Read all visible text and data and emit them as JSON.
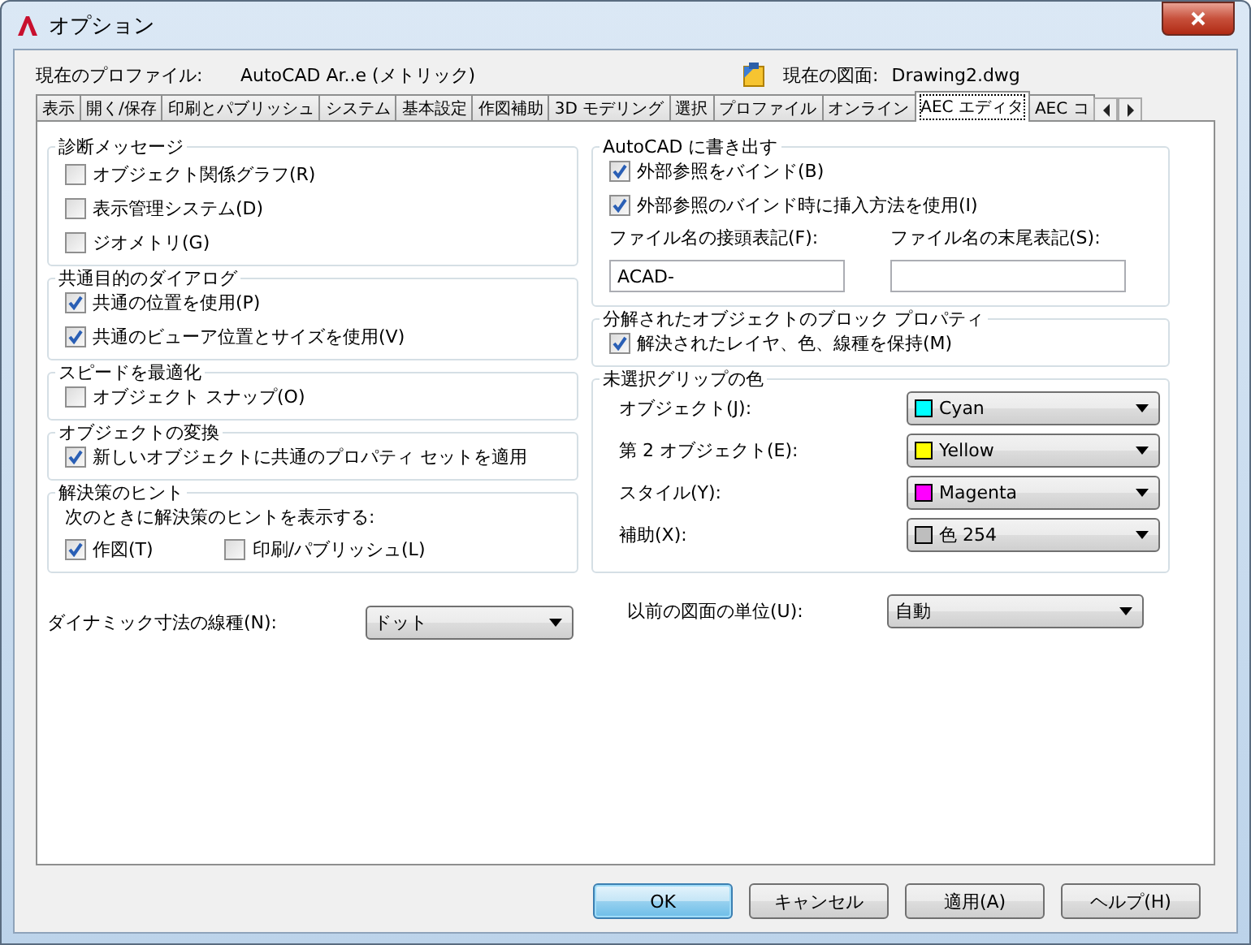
{
  "window": {
    "title": "オプション"
  },
  "profile": {
    "label": "現在のプロファイル:",
    "value": "AutoCAD Ar..e (メトリック)"
  },
  "drawing": {
    "label": "現在の図面:",
    "value": "Drawing2.dwg"
  },
  "tabs": [
    {
      "label": "表示",
      "selected": false
    },
    {
      "label": "開く/保存",
      "selected": false
    },
    {
      "label": "印刷とパブリッシュ",
      "selected": false
    },
    {
      "label": "システム",
      "selected": false
    },
    {
      "label": "基本設定",
      "selected": false
    },
    {
      "label": "作図補助",
      "selected": false
    },
    {
      "label": "3D モデリング",
      "selected": false
    },
    {
      "label": "選択",
      "selected": false
    },
    {
      "label": "プロファイル",
      "selected": false
    },
    {
      "label": "オンライン",
      "selected": false
    },
    {
      "label": "AEC エディタ",
      "selected": true
    },
    {
      "label": "AEC コ",
      "selected": false
    }
  ],
  "left_groups": [
    {
      "title": "診断メッセージ",
      "items": [
        {
          "label": "オブジェクト関係グラフ(R)",
          "checked": false
        },
        {
          "label": "表示管理システム(D)",
          "checked": false
        },
        {
          "label": "ジオメトリ(G)",
          "checked": false
        }
      ]
    },
    {
      "title": "共通目的のダイアログ",
      "items": [
        {
          "label": "共通の位置を使用(P)",
          "checked": true
        },
        {
          "label": "共通のビューア位置とサイズを使用(V)",
          "checked": true
        }
      ]
    },
    {
      "title": "スピードを最適化",
      "items": [
        {
          "label": "オブジェクト スナップ(O)",
          "checked": false
        }
      ]
    },
    {
      "title": "オブジェクトの変換",
      "items": [
        {
          "label": "新しいオブジェクトに共通のプロパティ セットを適用",
          "checked": true
        }
      ]
    },
    {
      "title": "解決策のヒント",
      "note": "次のときに解決策のヒントを表示する:",
      "items": [
        {
          "label": "作図(T)",
          "checked": true
        },
        {
          "label": "印刷/パブリッシュ(L)",
          "checked": false
        }
      ]
    }
  ],
  "dynamic_linetype": {
    "label": "ダイナミック寸法の線種(N):",
    "value": "ドット"
  },
  "export_group": {
    "title": "AutoCAD に書き出す",
    "items": [
      {
        "label": "外部参照をバインド(B)",
        "checked": true
      },
      {
        "label": "外部参照のバインド時に挿入方法を使用(I)",
        "checked": true
      }
    ],
    "fields": [
      {
        "label": "ファイル名の接頭表記(F):",
        "value": "ACAD-"
      },
      {
        "label": "ファイル名の末尾表記(S):"
      }
    ]
  },
  "explode_group": {
    "title": "分解されたオブジェクトのブロック プロパティ",
    "items": [
      {
        "label": "解決されたレイヤ、色、線種を保持(M)",
        "checked": true
      }
    ]
  },
  "grip_group": {
    "title": "未選択グリップの色",
    "rows": [
      {
        "label": "オブジェクト(J):",
        "value": "Cyan",
        "color": "#00ffff"
      },
      {
        "label": "第 2 オブジェクト(E):",
        "value": "Yellow",
        "color": "#ffff00"
      },
      {
        "label": "スタイル(Y):",
        "value": "Magenta",
        "color": "#ff00ff"
      },
      {
        "label": "補助(X):",
        "value": "色 254",
        "color": "#bebebe"
      }
    ]
  },
  "prior_units": {
    "label": "以前の図面の単位(U):",
    "value": "自動"
  },
  "buttons": [
    {
      "label": "OK",
      "default": true
    },
    {
      "label": "キャンセル",
      "default": false
    },
    {
      "label": "適用(A)",
      "default": false
    },
    {
      "label": "ヘルプ(H)",
      "default": false
    }
  ]
}
